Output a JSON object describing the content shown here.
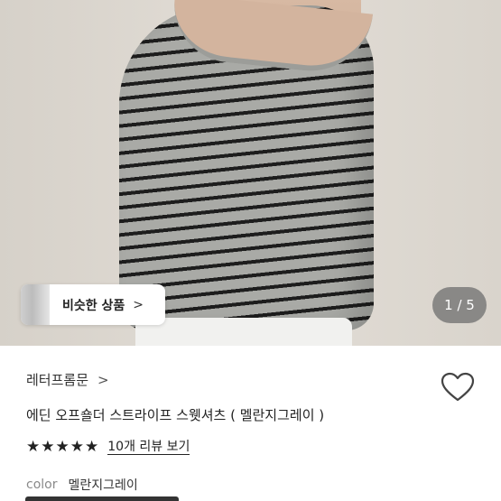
{
  "gallery": {
    "similar_products_label": "비슷한 상품",
    "page_counter": "1 / 5"
  },
  "product": {
    "brand": "레터프롬문",
    "title": "에딘 오프숄더 스트라이프 스웻셔츠 ( 멜란지그레이 )",
    "rating_stars": 5,
    "review_link": "10개 리뷰 보기",
    "color_label": "color",
    "color_value": "멜란지그레이"
  },
  "icons": {
    "wishlist": "heart-outline-icon",
    "similar_chevron": "chevron-right-icon",
    "brand_chevron": "chevron-right-icon",
    "star": "star-filled-icon"
  },
  "colors": {
    "text_primary": "#222222",
    "text_muted": "#8a8a8a",
    "counter_bg": "#6e6e6e"
  }
}
